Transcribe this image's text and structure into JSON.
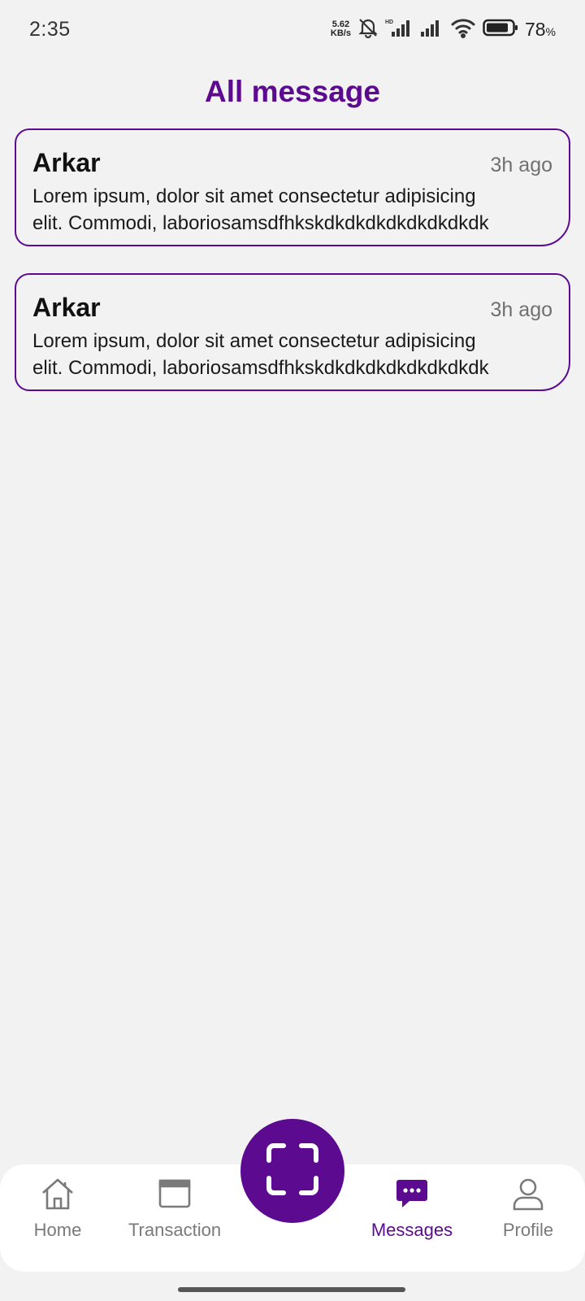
{
  "status_bar": {
    "time": "2:35",
    "net_speed_value": "5.62",
    "net_speed_unit": "KB/s",
    "battery_percent": "78",
    "battery_symbol": "%"
  },
  "page": {
    "title": "All message"
  },
  "messages": [
    {
      "sender": "Arkar",
      "time": "3h ago",
      "body": "Lorem ipsum, dolor sit amet consectetur adipisicing\nelit. Commodi, laboriosamsdfhkskdkdkdkdkdkdkdkdk"
    },
    {
      "sender": "Arkar",
      "time": "3h ago",
      "body": "Lorem ipsum, dolor sit amet consectetur adipisicing\nelit. Commodi, laboriosamsdfhkskdkdkdkdkdkdkdkdk"
    }
  ],
  "nav": {
    "items": [
      {
        "label": "Home",
        "icon": "home-icon",
        "active": false
      },
      {
        "label": "Transaction",
        "icon": "window-icon",
        "active": false
      },
      {
        "label": "Messages",
        "icon": "chat-bubble-icon",
        "active": true
      },
      {
        "label": "Profile",
        "icon": "user-icon",
        "active": false
      }
    ],
    "scan_icon": "scan-icon"
  },
  "colors": {
    "accent": "#5c0a8f",
    "background": "#f2f2f2",
    "inactive": "#7a7a7a"
  }
}
